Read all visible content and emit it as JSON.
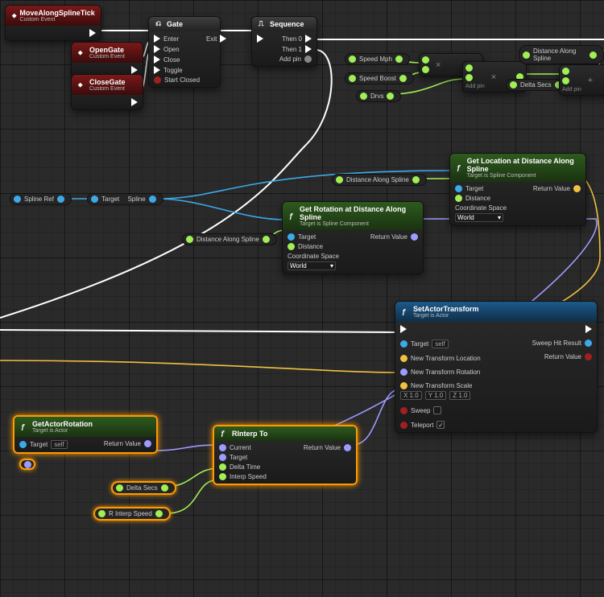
{
  "events": {
    "moveTick": {
      "title": "MoveAlongSplineTick",
      "sub": "Custom Event"
    },
    "openGate": {
      "title": "OpenGate",
      "sub": "Custom Event"
    },
    "closeGate": {
      "title": "CloseGate",
      "sub": "Custom Event"
    }
  },
  "gate": {
    "title": "Gate",
    "in_enter": "Enter",
    "in_open": "Open",
    "in_close": "Close",
    "in_toggle": "Toggle",
    "start_closed": "Start Closed",
    "out_exit": "Exit"
  },
  "sequence": {
    "title": "Sequence",
    "then0": "Then 0",
    "then1": "Then 1",
    "addpin": "Add pin"
  },
  "speedMph": "Speed Mph",
  "speedBoost": "Speed Boost",
  "drvs": "Drvs",
  "distAlong": "Distance Along Spline",
  "mul": {
    "title": "×",
    "addpin": "Add pin"
  },
  "add": {
    "title": "+",
    "addpin": "Add pin",
    "deltaSecs": "Delta Secs"
  },
  "splineRef": "Spline Ref",
  "targetSpline": {
    "target": "Target",
    "spline": "Spline"
  },
  "getLoc": {
    "title": "Get Location at Distance Along Spline",
    "sub": "Target is Spline Component",
    "target": "Target",
    "distance": "Distance",
    "coord": "Coordinate Space",
    "world": "World",
    "ret": "Return Value"
  },
  "getRot": {
    "title": "Get Rotation at Distance Along Spline",
    "sub": "Target is Spline Component",
    "target": "Target",
    "distance": "Distance",
    "coord": "Coordinate Space",
    "world": "World",
    "ret": "Return Value"
  },
  "getActorRot": {
    "title": "GetActorRotation",
    "sub": "Target is Actor",
    "target": "Target",
    "self": "self",
    "ret": "Return Value"
  },
  "rinterp": {
    "title": "RInterp To",
    "current": "Current",
    "target": "Target",
    "delta": "Delta Time",
    "speed": "Interp Speed",
    "ret": "Return Value"
  },
  "deltaSecs": "Delta Secs",
  "rinterpSpeed": "R Interp Speed",
  "setXform": {
    "title": "SetActorTransform",
    "sub": "Target is Actor",
    "target": "Target",
    "self": "self",
    "loc": "New Transform Location",
    "rot": "New Transform Rotation",
    "scale": "New Transform Scale",
    "x": "X 1.0",
    "y": "Y 1.0",
    "z": "Z 1.0",
    "sweep": "Sweep",
    "teleport": "Teleport",
    "hit": "Sweep Hit Result",
    "ret": "Return Value"
  }
}
